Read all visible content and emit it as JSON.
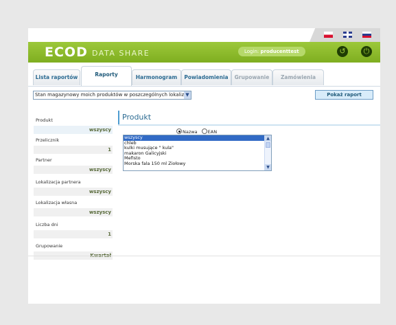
{
  "header": {
    "logo": "ECOD",
    "subtitle": "DATA SHARE",
    "login_label": "Login:",
    "login_user": "producenttest",
    "back_icon": "back-arrow-icon",
    "power_icon": "power-icon"
  },
  "flags": [
    "flag-pl",
    "flag-uk",
    "flag-ru"
  ],
  "tabs": [
    {
      "label": "Lista raportów",
      "state": "normal"
    },
    {
      "label": "Raporty",
      "state": "active"
    },
    {
      "label": "Harmonogram",
      "state": "normal"
    },
    {
      "label": "Powiadomienia",
      "state": "normal"
    },
    {
      "label": "Grupowanie",
      "state": "disabled"
    },
    {
      "label": "Zamówienia",
      "state": "disabled"
    }
  ],
  "report": {
    "selected": "Stan magazynowy moich produktów w poszczególnych lokalizacjach w",
    "show_button": "Pokaż raport"
  },
  "sidebar": [
    {
      "label": "Produkt",
      "value": "wszyscy"
    },
    {
      "label": "Przelicznik",
      "value": "1"
    },
    {
      "label": "Partner",
      "value": "wszyscy"
    },
    {
      "label": "Lokalizacja partnera",
      "value": "wszyscy"
    },
    {
      "label": "Lokalizacja własna",
      "value": "wszyscy"
    },
    {
      "label": "Liczba dni",
      "value": "1"
    },
    {
      "label": "Grupowanie",
      "value": "Kwartał"
    }
  ],
  "product_panel": {
    "title": "Produkt",
    "radio_name": "Nazwa",
    "radio_ean": "EAN",
    "items": [
      "wszyscy",
      "chleb",
      "kulki musujące \" kula\"",
      "makaron Galicyjski",
      "Mefisto",
      "Morska fala 150 ml Ziołowy"
    ],
    "selected_index": 0
  }
}
